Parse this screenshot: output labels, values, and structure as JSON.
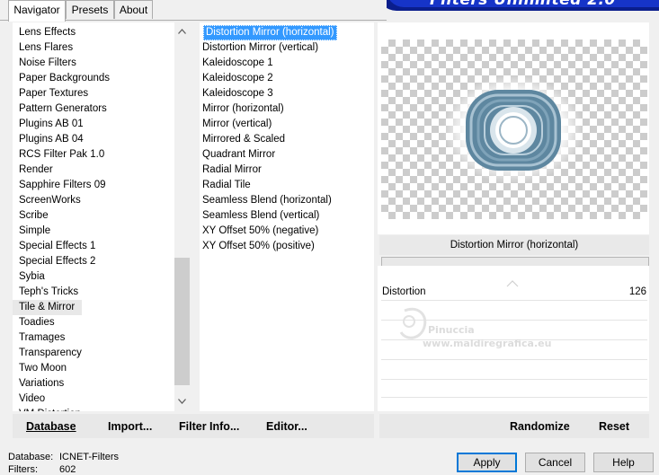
{
  "tabs": [
    "Navigator",
    "Presets",
    "About"
  ],
  "banner_title": "Filters Unlimited 2.0",
  "categories": [
    "Lens Effects",
    "Lens Flares",
    "Noise Filters",
    "Paper Backgrounds",
    "Paper Textures",
    "Pattern Generators",
    "Plugins AB 01",
    "Plugins AB 04",
    "RCS Filter Pak 1.0",
    "Render",
    "Sapphire Filters 09",
    "ScreenWorks",
    "Scribe",
    "Simple",
    "Special Effects 1",
    "Special Effects 2",
    "Sybia",
    "Teph's Tricks",
    "Tile & Mirror",
    "Toadies",
    "Tramages",
    "Transparency",
    "Two Moon",
    "Variations",
    "Video",
    "VM Distortion"
  ],
  "selected_category": "Tile & Mirror",
  "filters": [
    "Distortion Mirror (horizontal)",
    "Distortion Mirror (vertical)",
    "Kaleidoscope 1",
    "Kaleidoscope 2",
    "Kaleidoscope 3",
    "Mirror (horizontal)",
    "Mirror (vertical)",
    "Mirrored & Scaled",
    "Quadrant Mirror",
    "Radial Mirror",
    "Radial Tile",
    "Seamless Blend (horizontal)",
    "Seamless Blend (vertical)",
    "XY Offset 50% (negative)",
    "XY Offset 50% (positive)"
  ],
  "selected_filter": "Distortion Mirror (horizontal)",
  "filter_title": "Distortion Mirror (horizontal)",
  "param": {
    "label": "Distortion",
    "value": "126"
  },
  "watermark": {
    "line1": "Pinuccia",
    "line2": "www.maldiregrafica.eu"
  },
  "left_buttons": {
    "database": "Database",
    "import": "Import...",
    "filter_info": "Filter Info...",
    "editor": "Editor..."
  },
  "right_buttons": {
    "randomize": "Randomize",
    "reset": "Reset"
  },
  "status": {
    "database_label": "Database:",
    "database_value": "ICNET-Filters",
    "filters_label": "Filters:",
    "filters_value": "602"
  },
  "dialog_buttons": {
    "apply": "Apply",
    "cancel": "Cancel",
    "help": "Help"
  },
  "scroll_up_icon": "chevron-up-icon",
  "scroll_down_icon": "chevron-down-icon"
}
